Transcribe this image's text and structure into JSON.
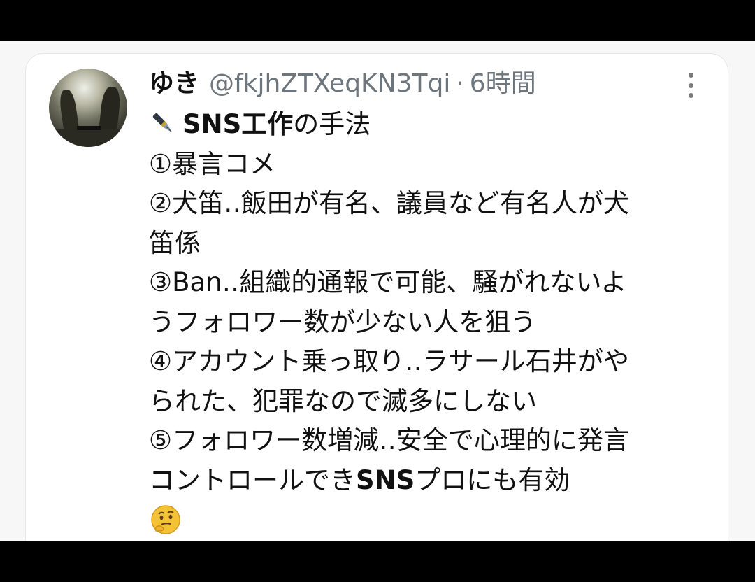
{
  "tweet": {
    "name": "ゆき",
    "handle": "@fkjhZTXeqKN3Tqi",
    "separator": "·",
    "time": "6時間",
    "title_bold": "SNS工作",
    "title_rest": "の手法",
    "lines": [
      "①暴言コメ",
      "②犬笛‥飯田が有名、議員など有名人が犬",
      "笛係",
      "③Ban‥組織的通報で可能、騒がれないよ",
      "うフォロワー数が少ない人を狙う",
      "④アカウント乗っ取り‥ラサール石井がや",
      "られた、犯罪なので滅多にしない",
      "⑤フォロワー数増減‥安全で心理的に発言"
    ],
    "last_line_a": "コントロールでき",
    "last_line_b": "SNS",
    "last_line_c": "プロにも有効"
  },
  "icons": {
    "pen": "fountain-pen-emoji",
    "thinking": "thinking-face-emoji",
    "more": "more-options-icon"
  }
}
